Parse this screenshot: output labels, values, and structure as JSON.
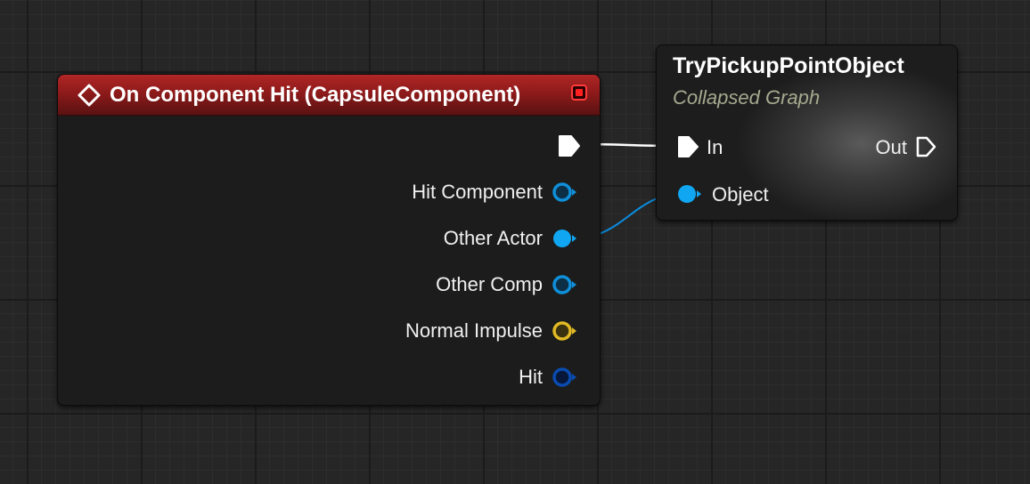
{
  "event_node": {
    "title": "On Component Hit (CapsuleComponent)",
    "header_color": "#9a1f1f",
    "icon": "event-diamond-icon",
    "close_icon": "close-icon",
    "pins": [
      {
        "label": "Hit Component",
        "type": "object",
        "color": "#0f8fd9",
        "connected": false
      },
      {
        "label": "Other Actor",
        "type": "object",
        "color": "#10a6f2",
        "connected": true
      },
      {
        "label": "Other Comp",
        "type": "object",
        "color": "#0f8fd9",
        "connected": false
      },
      {
        "label": "Normal Impulse",
        "type": "vector",
        "color": "#e2b925",
        "connected": false
      },
      {
        "label": "Hit",
        "type": "struct",
        "color": "#0a4bb0",
        "connected": false
      }
    ]
  },
  "graph_node": {
    "title": "TryPickupPointObject",
    "subtitle": "Collapsed Graph",
    "pins": {
      "exec_in": "In",
      "exec_out": "Out",
      "object_in": "Object"
    }
  },
  "colors": {
    "exec_wire": "#ffffff",
    "object_wire": "#0a8de0",
    "grid_bg": "#262626"
  }
}
